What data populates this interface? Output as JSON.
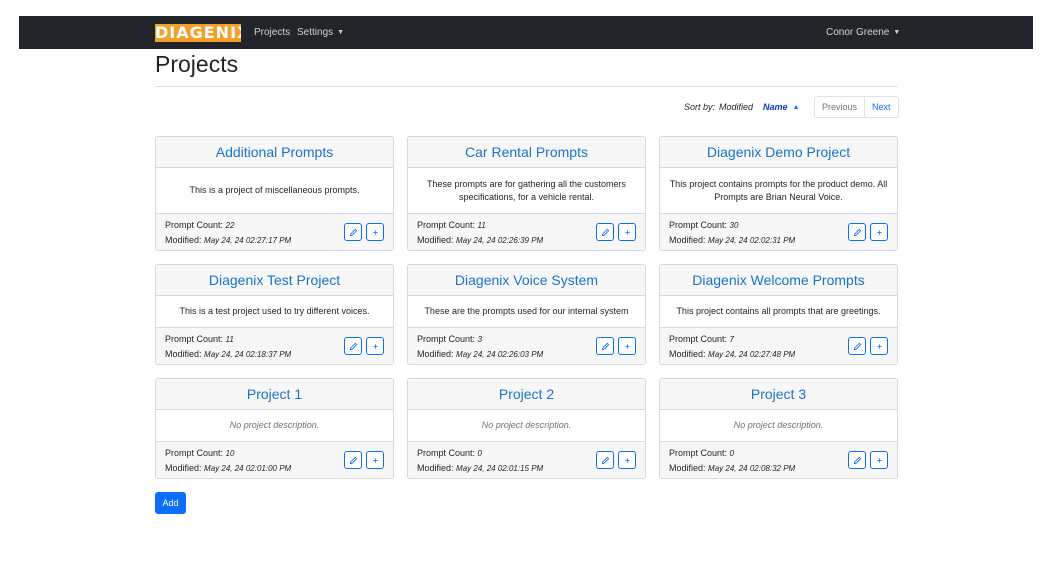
{
  "navbar": {
    "logo_text": "DIAGENIX",
    "links": {
      "projects": "Projects",
      "settings": "Settings"
    },
    "user": "Conor Greene"
  },
  "page": {
    "title": "Projects"
  },
  "sort": {
    "label": "Sort by:",
    "options": [
      "Modified",
      "Name"
    ],
    "active": "Name",
    "direction": "ascending"
  },
  "pagination": {
    "previous": "Previous",
    "next": "Next"
  },
  "card_labels": {
    "prompt_count": "Prompt Count:",
    "modified": "Modified:"
  },
  "projects": [
    {
      "name": "Additional Prompts",
      "description": "This is a project of miscellaneous prompts.",
      "prompt_count": "22",
      "modified": "May 24, 24 02:27:17 PM"
    },
    {
      "name": "Car Rental Prompts",
      "description": "These prompts are for gathering all the customers specifications, for a vehicle rental.",
      "prompt_count": "11",
      "modified": "May 24, 24 02:26:39 PM"
    },
    {
      "name": "Diagenix Demo Project",
      "description": "This project contains prompts for the product demo. All Prompts are Brian Neural Voice.",
      "prompt_count": "30",
      "modified": "May 24, 24 02:02:31 PM"
    },
    {
      "name": "Diagenix Test Project",
      "description": "This is a test project used to try different voices.",
      "prompt_count": "11",
      "modified": "May 24, 24 02:18:37 PM"
    },
    {
      "name": "Diagenix Voice System",
      "description": "These are the prompts used for our internal system",
      "prompt_count": "3",
      "modified": "May 24, 24 02:26:03 PM"
    },
    {
      "name": "Diagenix Welcome Prompts",
      "description": "This project contains all prompts that are greetings.",
      "prompt_count": "7",
      "modified": "May 24, 24 02:27:48 PM"
    },
    {
      "name": "Project 1",
      "description": "No project description.",
      "prompt_count": "10",
      "modified": "May 24, 24 02:01:00 PM"
    },
    {
      "name": "Project 2",
      "description": "No project description.",
      "prompt_count": "0",
      "modified": "May 24, 24 02:01:15 PM"
    },
    {
      "name": "Project 3",
      "description": "No project description.",
      "prompt_count": "0",
      "modified": "May 24, 24 02:08:32 PM"
    }
  ],
  "actions": {
    "add": "Add"
  },
  "colors": {
    "navbar": "#212529",
    "logo": "#f2a028",
    "primary": "#0d6efd",
    "card_title": "#1a73c9"
  },
  "icons": {
    "edit": "pencil-icon",
    "add_prompt": "plus-icon",
    "sort_direction": "caret-up-icon",
    "dropdown": "caret-down-icon"
  }
}
